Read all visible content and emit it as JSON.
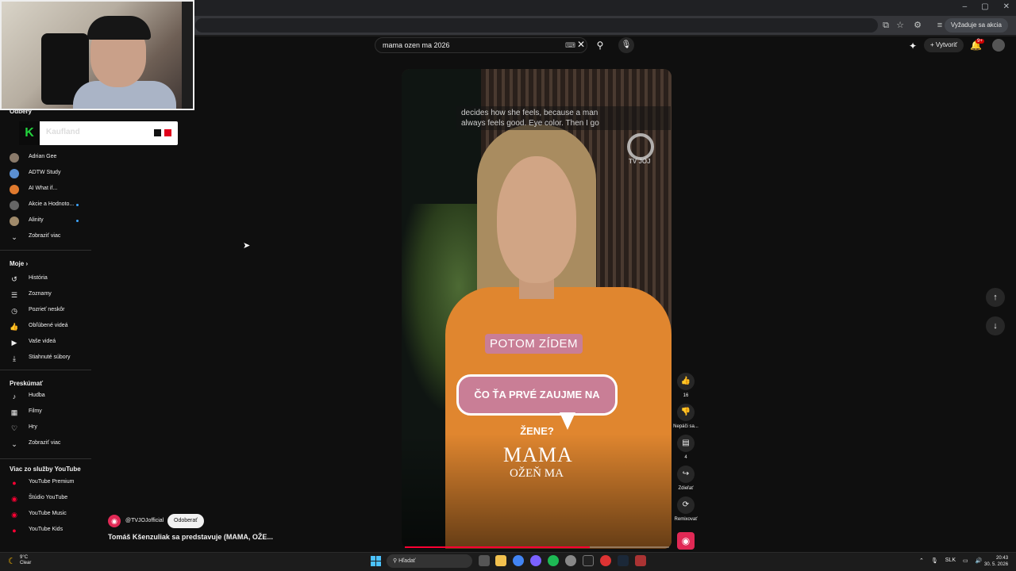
{
  "browser": {
    "window_controls": [
      "–",
      "▢",
      "✕"
    ],
    "update_button": "Vyžaduje sa akcia"
  },
  "header": {
    "search_query": "mama ozen ma 2026",
    "create_label": "Vytvoriť",
    "notification_badge": "9+"
  },
  "overlay_widget": {
    "logo": "K",
    "text": "Kaufland"
  },
  "sidebar": {
    "subscriptions_heading": "Odbery",
    "subscriptions": [
      {
        "label": "Adrian Gee",
        "color": "#8a7a6a",
        "dot": false
      },
      {
        "label": "ADTW Study",
        "color": "#5a8fd1",
        "dot": false
      },
      {
        "label": "AI What if...",
        "color": "#e07a2e",
        "dot": false
      },
      {
        "label": "Akcie a Hodnoto...",
        "color": "#666666",
        "dot": true
      },
      {
        "label": "Alinity",
        "color": "#a08a6a",
        "dot": true
      }
    ],
    "subscriptions_more": "Zobraziť viac",
    "my_heading": "Moje",
    "my_items": [
      {
        "label": "História",
        "icon": "history-icon"
      },
      {
        "label": "Zoznamy",
        "icon": "playlists-icon"
      },
      {
        "label": "Pozrieť neskôr",
        "icon": "watch-later-icon"
      },
      {
        "label": "Obľúbené videá",
        "icon": "liked-icon"
      },
      {
        "label": "Vaše videá",
        "icon": "your-videos-icon"
      },
      {
        "label": "Stiahnuté súbory",
        "icon": "downloads-icon"
      }
    ],
    "explore_heading": "Preskúmať",
    "explore_items": [
      {
        "label": "Hudba",
        "icon": "music-icon"
      },
      {
        "label": "Filmy",
        "icon": "movies-icon"
      },
      {
        "label": "Hry",
        "icon": "games-icon"
      }
    ],
    "explore_more": "Zobraziť viac",
    "more_heading": "Viac zo služby YouTube",
    "more_items": [
      {
        "label": "YouTube Premium"
      },
      {
        "label": "Štúdio YouTube"
      },
      {
        "label": "YouTube Music"
      },
      {
        "label": "YouTube Kids"
      }
    ]
  },
  "short": {
    "caption_line1": "decides how she feels, because a man",
    "caption_line2": "always feels good.  Eye color.  Then I go",
    "watermark": "TV JOJ",
    "overlay_top": "POTOM ZÍDEM",
    "overlay_bubble": "ČO ŤA PRVÉ ZAUJME NA ŽENE?",
    "show_title": "MAMA",
    "show_subtitle": "OŽEŇ MA",
    "progress": 0.7
  },
  "actions": {
    "like_count": "16",
    "dislike_label": "Nepáči sa...",
    "comment_count": "4",
    "share_label": "Zdieľať",
    "remix_label": "Remixovať"
  },
  "channel": {
    "handle": "@TVJOJofficial",
    "subscribe_label": "Odoberať",
    "video_title": "Tomáš Kšenzuliak sa predstavuje (MAMA, OŽE..."
  },
  "taskbar": {
    "temp": "9°C",
    "weather": "Clear",
    "search_label": "Hľadať",
    "lang": "SLK",
    "time": "20:43",
    "date": "30. 5. 2026"
  }
}
